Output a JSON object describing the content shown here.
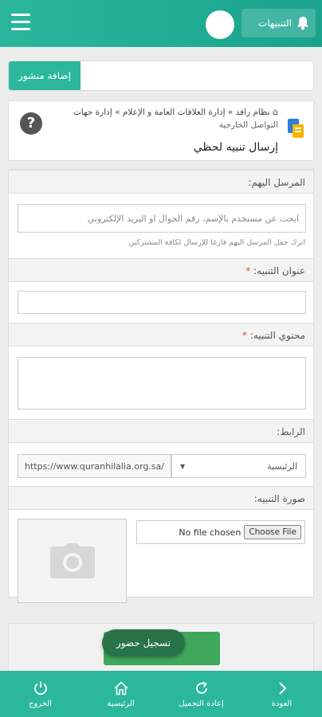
{
  "header": {
    "notifications_label": "التنبيهات"
  },
  "add_post": {
    "label": "إضافة منشور"
  },
  "breadcrumb": {
    "path": "نظام رافد » إدارة العلاقات العامة و الإعلام » إدارة جهات",
    "path_sub": "التواصل الخارجية",
    "title": "إرسال تنبيه لحظي"
  },
  "form": {
    "recipients_label": "المرسل اليهم:",
    "recipients_placeholder": "ابحث عن مستخدم بالإسم، رقم الجوال او البريد الإلكتروني",
    "recipients_hint": "اترك حقل المرسل اليهم فارغا للإرسال لكافة المشتركين",
    "title_label": "عنوان التنبيه:",
    "content_label": "محتوي التنبيه:",
    "required_mark": "*",
    "link_label": "الرابط:",
    "link_select": "الرئيسية",
    "link_value": "https://www.quranhilalia.org.sa/",
    "image_label": "صورة التنبيه:",
    "file_status": "No file chosen",
    "choose_file": "Choose File"
  },
  "attendance": {
    "label": "تسجيل حضور"
  },
  "bottom_nav": [
    {
      "label": "الخروج",
      "icon": "power-icon"
    },
    {
      "label": "الرئيسية",
      "icon": "home-icon"
    },
    {
      "label": "إعادة التحميل",
      "icon": "reload-icon"
    },
    {
      "label": "العودة",
      "icon": "back-icon"
    }
  ],
  "colors": {
    "primary": "#2ab79c",
    "attend": "#28734a",
    "submit": "#3ea85a",
    "required": "#e74c3c"
  }
}
